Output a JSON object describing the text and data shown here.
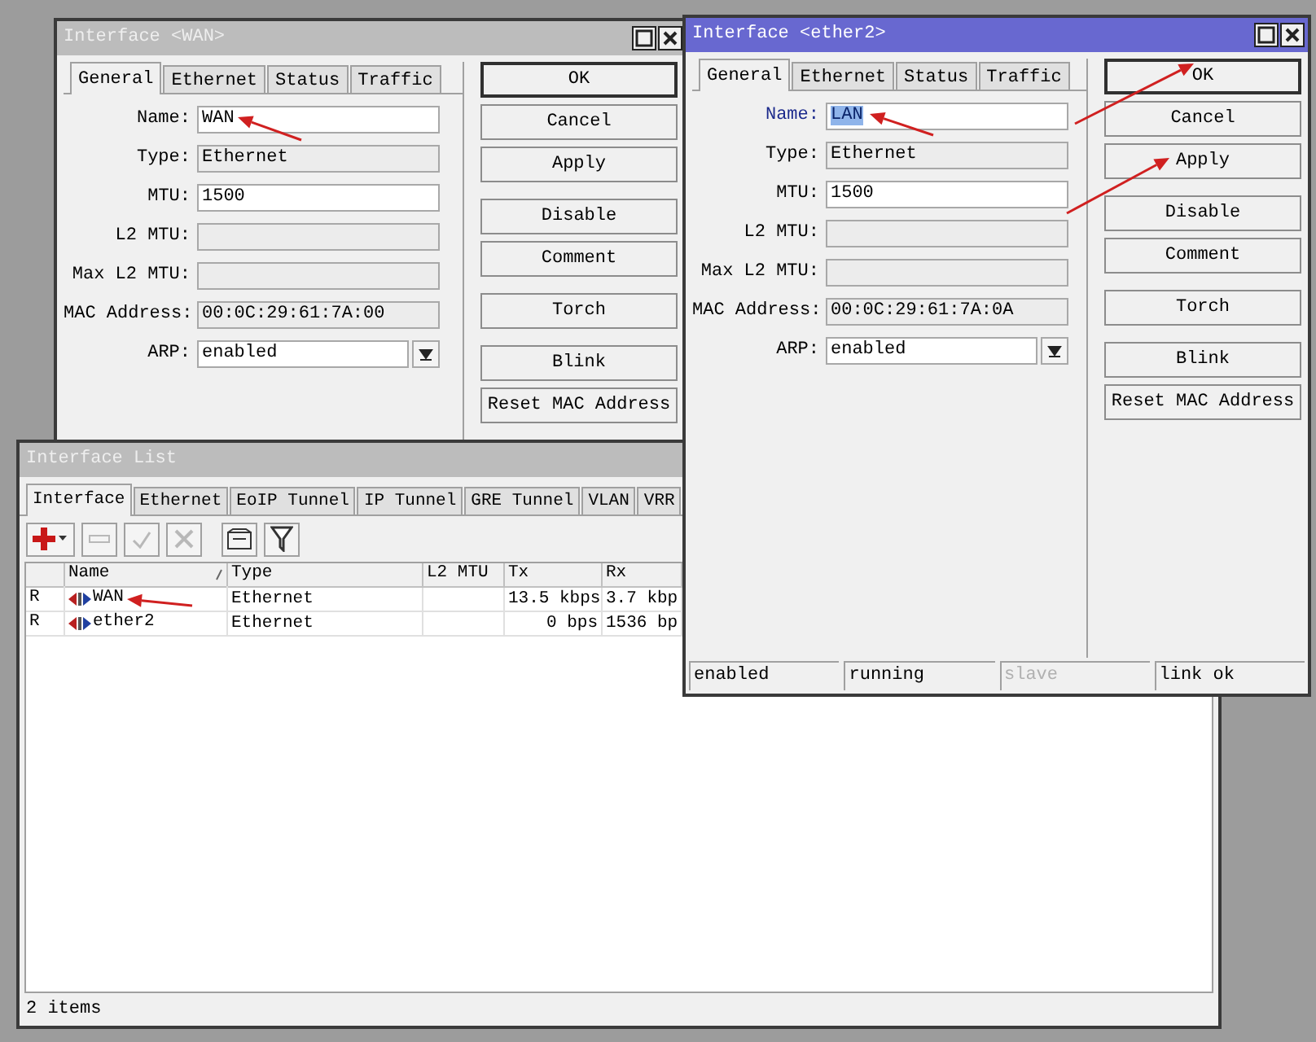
{
  "wan_window": {
    "title": "Interface <WAN>",
    "active": false,
    "tabs": [
      {
        "label": "General",
        "selected": true
      },
      {
        "label": "Ethernet",
        "selected": false
      },
      {
        "label": "Status",
        "selected": false
      },
      {
        "label": "Traffic",
        "selected": false
      }
    ],
    "fields": [
      {
        "label": "Name:",
        "value": "WAN",
        "kind": "text",
        "editable": true,
        "focused": false,
        "value_selected": false
      },
      {
        "label": "Type:",
        "value": "Ethernet",
        "kind": "text",
        "editable": false,
        "focused": false,
        "value_selected": false
      },
      {
        "label": "MTU:",
        "value": "1500",
        "kind": "text",
        "editable": true,
        "focused": false,
        "value_selected": false
      },
      {
        "label": "L2 MTU:",
        "kind": "text",
        "editable": false,
        "focused": false
      },
      {
        "label": "Max L2 MTU:",
        "kind": "text",
        "editable": false,
        "focused": false
      },
      {
        "label": "MAC Address:",
        "value": "00:0C:29:61:7A:00",
        "kind": "text",
        "editable": false,
        "focused": false,
        "value_selected": false
      },
      {
        "label": "ARP:",
        "value": "enabled",
        "kind": "dropdown",
        "editable": true,
        "focused": false,
        "value_selected": false
      }
    ],
    "button_groups": [
      [
        {
          "label": "OK",
          "default": true
        },
        {
          "label": "Cancel",
          "default": false
        },
        {
          "label": "Apply",
          "default": false
        }
      ],
      [
        {
          "label": "Disable",
          "default": false
        },
        {
          "label": "Comment",
          "default": false
        }
      ],
      [
        {
          "label": "Torch",
          "default": false
        }
      ],
      [
        {
          "label": "Blink",
          "default": false
        },
        {
          "label": "Reset MAC Address",
          "default": false
        }
      ]
    ]
  },
  "interface_list_window": {
    "title": "Interface List",
    "active": false,
    "tabs": [
      {
        "label": "Interface",
        "selected": true
      },
      {
        "label": "Ethernet",
        "selected": false
      },
      {
        "label": "EoIP Tunnel",
        "selected": false
      },
      {
        "label": "IP Tunnel",
        "selected": false
      },
      {
        "label": "GRE Tunnel",
        "selected": false
      },
      {
        "label": "VLAN",
        "selected": false
      },
      {
        "label": "VRR",
        "selected": false
      }
    ],
    "toolbar": [
      {
        "kind": "add",
        "disabled": false
      },
      {
        "kind": "remove",
        "disabled": true
      },
      {
        "kind": "enable",
        "disabled": true
      },
      {
        "kind": "disable",
        "disabled": true
      },
      {
        "kind": "comment",
        "disabled": false
      },
      {
        "kind": "filter",
        "disabled": false
      }
    ],
    "columns": [
      {
        "label": "Name",
        "sorted": true
      },
      {
        "label": "Type",
        "sorted": false
      },
      {
        "label": "L2 MTU",
        "sorted": false
      },
      {
        "label": "Tx",
        "sorted": false
      },
      {
        "label": "Rx",
        "sorted": false
      }
    ],
    "rows": [
      {
        "flag": "R",
        "name": "WAN",
        "type": "Ethernet",
        "tx": "13.5 kbps",
        "rx": "3.7 kbp"
      },
      {
        "flag": "R",
        "name": "ether2",
        "type": "Ethernet",
        "tx": "0 bps",
        "rx": "1536 bp"
      }
    ],
    "footer": "2 items"
  },
  "ether2_window": {
    "title": "Interface <ether2>",
    "active": true,
    "tabs": [
      {
        "label": "General",
        "selected": true
      },
      {
        "label": "Ethernet",
        "selected": false
      },
      {
        "label": "Status",
        "selected": false
      },
      {
        "label": "Traffic",
        "selected": false
      }
    ],
    "fields": [
      {
        "label": "Name:",
        "value": "LAN",
        "kind": "text",
        "editable": true,
        "focused": true,
        "value_selected": true
      },
      {
        "label": "Type:",
        "value": "Ethernet",
        "kind": "text",
        "editable": false,
        "focused": false,
        "value_selected": false
      },
      {
        "label": "MTU:",
        "value": "1500",
        "kind": "text",
        "editable": true,
        "focused": false,
        "value_selected": false
      },
      {
        "label": "L2 MTU:",
        "kind": "text",
        "editable": false,
        "focused": false
      },
      {
        "label": "Max L2 MTU:",
        "kind": "text",
        "editable": false,
        "focused": false
      },
      {
        "label": "MAC Address:",
        "value": "00:0C:29:61:7A:0A",
        "kind": "text",
        "editable": false,
        "focused": false,
        "value_selected": false
      },
      {
        "label": "ARP:",
        "value": "enabled",
        "kind": "dropdown",
        "editable": true,
        "focused": false,
        "value_selected": false
      }
    ],
    "button_groups": [
      [
        {
          "label": "OK",
          "default": true
        },
        {
          "label": "Cancel",
          "default": false
        },
        {
          "label": "Apply",
          "default": false
        }
      ],
      [
        {
          "label": "Disable",
          "default": false
        },
        {
          "label": "Comment",
          "default": false
        }
      ],
      [
        {
          "label": "Torch",
          "default": false
        }
      ],
      [
        {
          "label": "Blink",
          "default": false
        },
        {
          "label": "Reset MAC Address",
          "default": false
        }
      ]
    ],
    "status_bar": [
      {
        "text": "enabled",
        "disabled": false
      },
      {
        "text": "running",
        "disabled": false
      },
      {
        "text": "slave",
        "disabled": true
      },
      {
        "text": "link ok",
        "disabled": false
      }
    ]
  }
}
